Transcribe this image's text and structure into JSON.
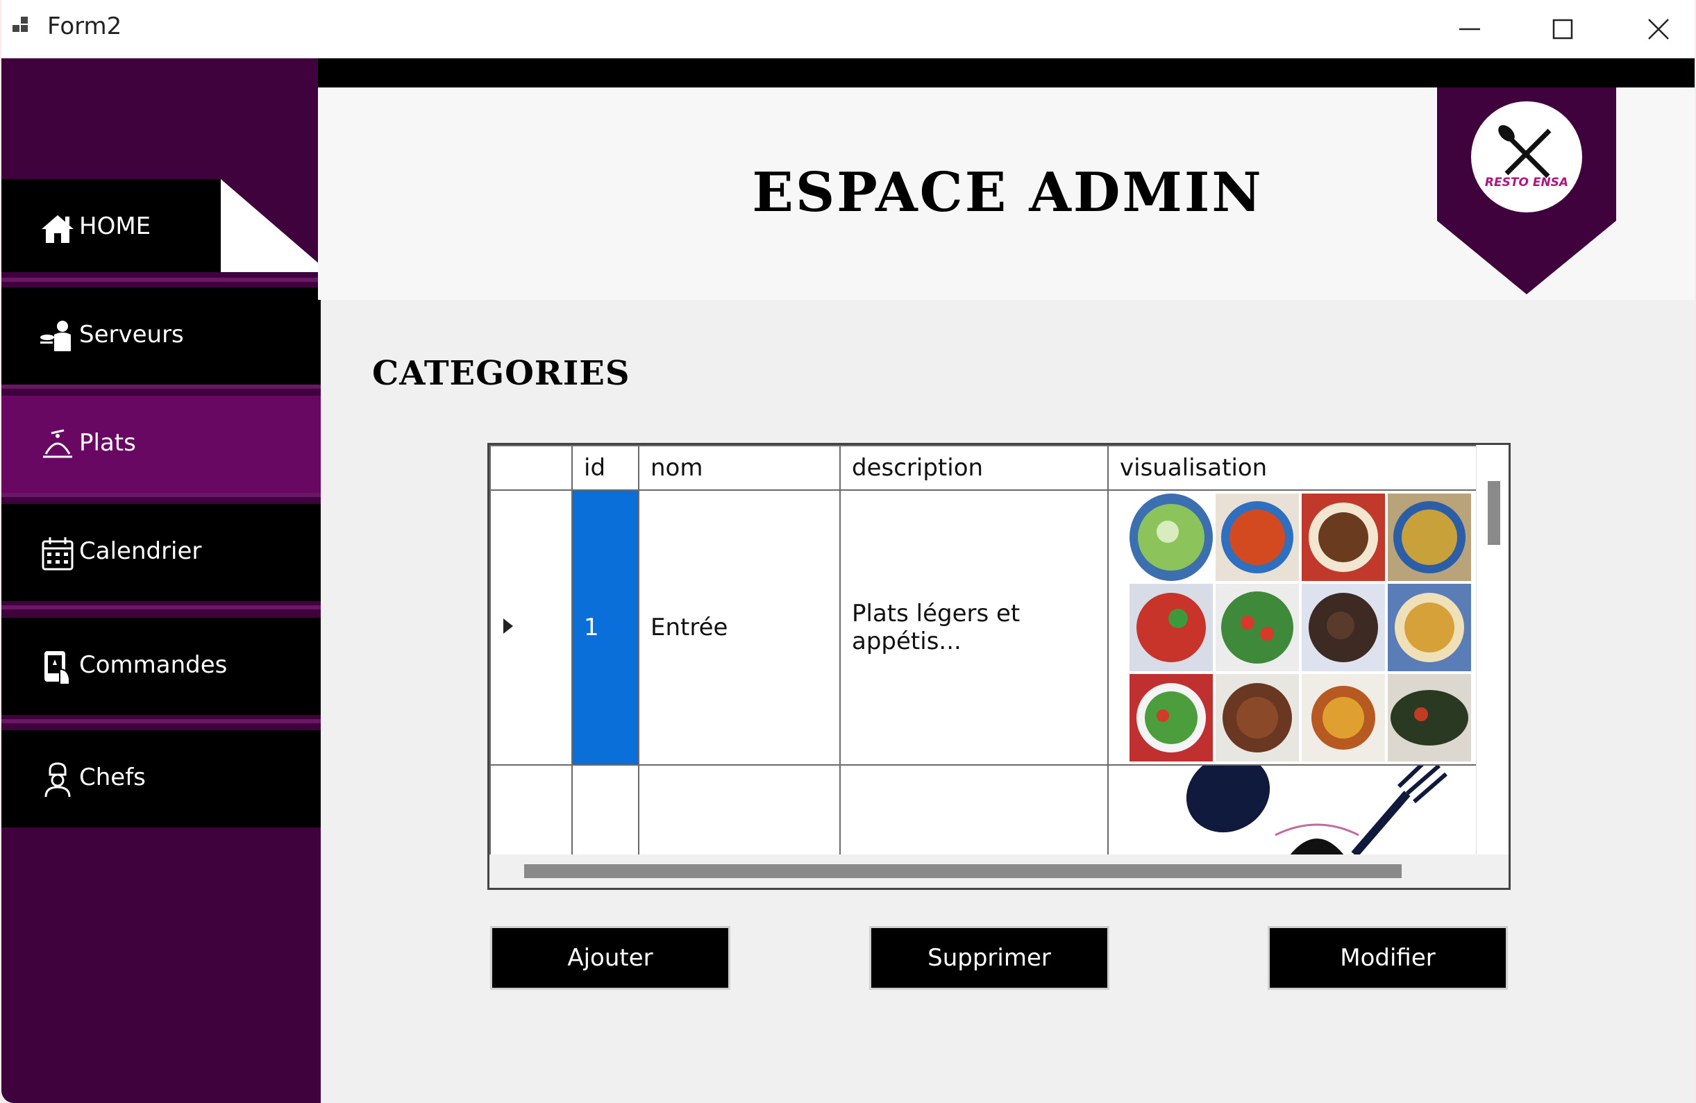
{
  "window": {
    "title": "Form2"
  },
  "header": {
    "title": "ESPACE ADMIN",
    "logo_text": "RESTO ENSA"
  },
  "sidebar": {
    "items": [
      {
        "label": "HOME",
        "icon": "home-icon",
        "active": false
      },
      {
        "label": "Serveurs",
        "icon": "waiter-icon",
        "active": false
      },
      {
        "label": "Plats",
        "icon": "dish-icon",
        "active": true
      },
      {
        "label": "Calendrier",
        "icon": "calendar-icon",
        "active": false
      },
      {
        "label": "Commandes",
        "icon": "order-icon",
        "active": false
      },
      {
        "label": "Chefs",
        "icon": "chef-icon",
        "active": false
      }
    ]
  },
  "main": {
    "section_title": "CATEGORIES",
    "grid": {
      "columns": [
        "id",
        "nom",
        "description",
        "visualisation"
      ],
      "rows": [
        {
          "id": "1",
          "nom": "Entrée",
          "description": "Plats légers et appétis...",
          "visualisation": "food-collage-image"
        }
      ],
      "new_row_visualisation": "utensils-logo-image"
    },
    "buttons": {
      "add": "Ajouter",
      "delete": "Supprimer",
      "edit": "Modifier"
    }
  },
  "colors": {
    "sidebar_bg": "#40023c",
    "active_item": "#690862",
    "selection": "#0a6fd8"
  }
}
